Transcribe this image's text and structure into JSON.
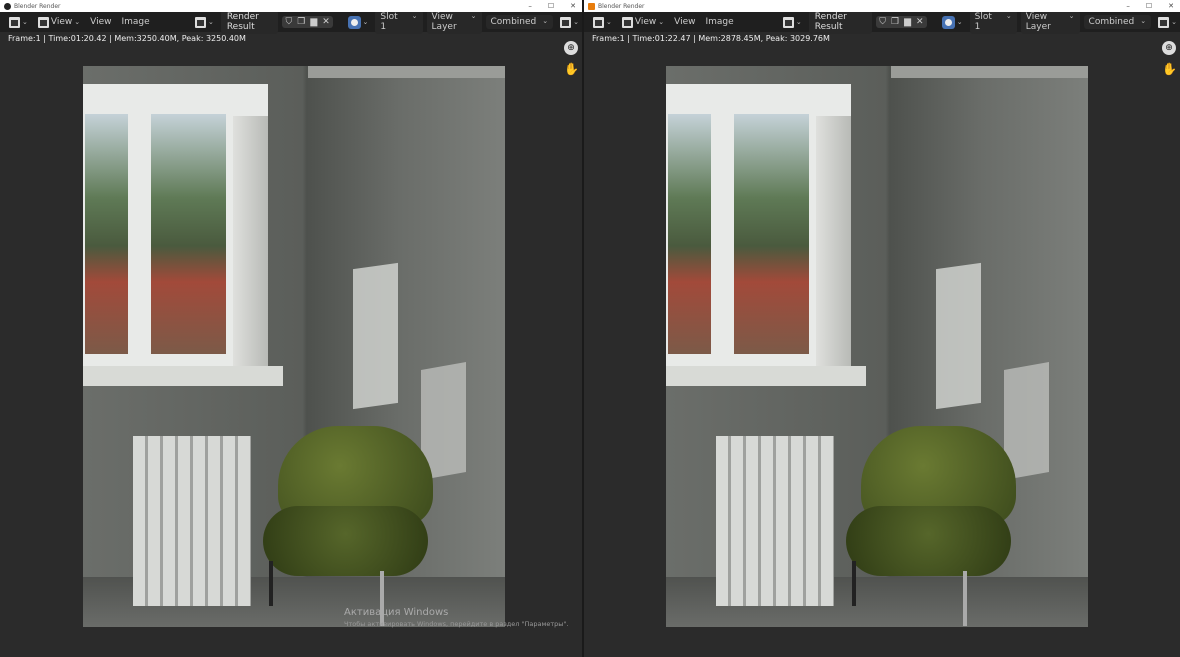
{
  "panes": [
    {
      "window_title": "Blender Render",
      "header": {
        "view_menu": "View",
        "view": "View",
        "image": "Image",
        "image_name": "Render Result",
        "slot": "Slot 1",
        "view_layer": "View Layer",
        "pass": "Combined"
      },
      "stats": "Frame:1 | Time:01:20.42 | Mem:3250.40M, Peak: 3250.40M"
    },
    {
      "window_title": "Blender Render",
      "header": {
        "view_menu": "View",
        "view": "View",
        "image": "Image",
        "image_name": "Render Result",
        "slot": "Slot 1",
        "view_layer": "View Layer",
        "pass": "Combined"
      },
      "stats": "Frame:1 | Time:01:22.47 | Mem:2878.45M, Peak: 3029.76M"
    }
  ],
  "watermark": {
    "title": "Активация Windows",
    "text": "Чтобы активировать Windows, перейдите в раздел \"Параметры\"."
  },
  "window_controls": {
    "minimize": "–",
    "maximize": "☐",
    "close": "✕"
  }
}
